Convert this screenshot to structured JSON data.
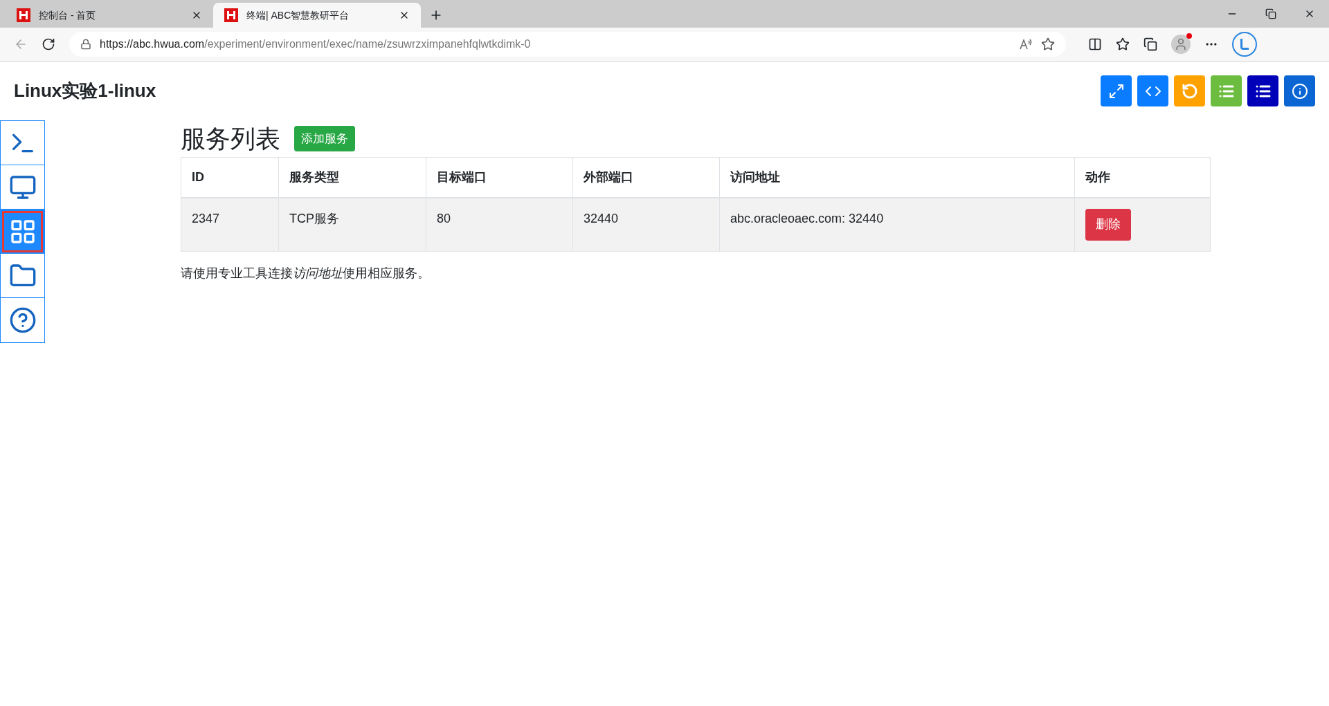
{
  "browser": {
    "tabs": [
      {
        "title": "控制台 - 首页",
        "selected": false
      },
      {
        "title": "终端| ABC智慧教研平台",
        "selected": true
      }
    ],
    "url": {
      "host": "https://abc.hwua.com",
      "path": "/experiment/environment/exec/name/zsuwrzximpanehfqlwtkdimk-0"
    }
  },
  "page_title": "Linux实验1-linux",
  "toolbar": [
    {
      "kind": "fullscreen",
      "color": "#0a7cff"
    },
    {
      "kind": "code",
      "color": "#0a7cff"
    },
    {
      "kind": "reset",
      "color": "#ffa200"
    },
    {
      "kind": "list",
      "color": "#6cbd3f"
    },
    {
      "kind": "list",
      "color": "#0000b8"
    },
    {
      "kind": "info",
      "color": "#0b66d4"
    }
  ],
  "sidebar": {
    "items": [
      {
        "kind": "terminal",
        "selected": false
      },
      {
        "kind": "desktop",
        "selected": false
      },
      {
        "kind": "services",
        "selected": true
      },
      {
        "kind": "files",
        "selected": false
      },
      {
        "kind": "help",
        "selected": false
      }
    ]
  },
  "heading": "服务列表",
  "add_button": "添加服务",
  "table": {
    "columns": [
      "ID",
      "服务类型",
      "目标端口",
      "外部端口",
      "访问地址",
      "动作"
    ],
    "rows": [
      {
        "cells": [
          "2347",
          "TCP服务",
          "80",
          "32440",
          "abc.oracleoaec.com: 32440"
        ],
        "action": "删除"
      }
    ]
  },
  "note": [
    {
      "text": "请使用专业工具连接",
      "italic": false
    },
    {
      "text": "访问地址",
      "italic": true
    },
    {
      "text": "使用相应服务。",
      "italic": false
    }
  ]
}
